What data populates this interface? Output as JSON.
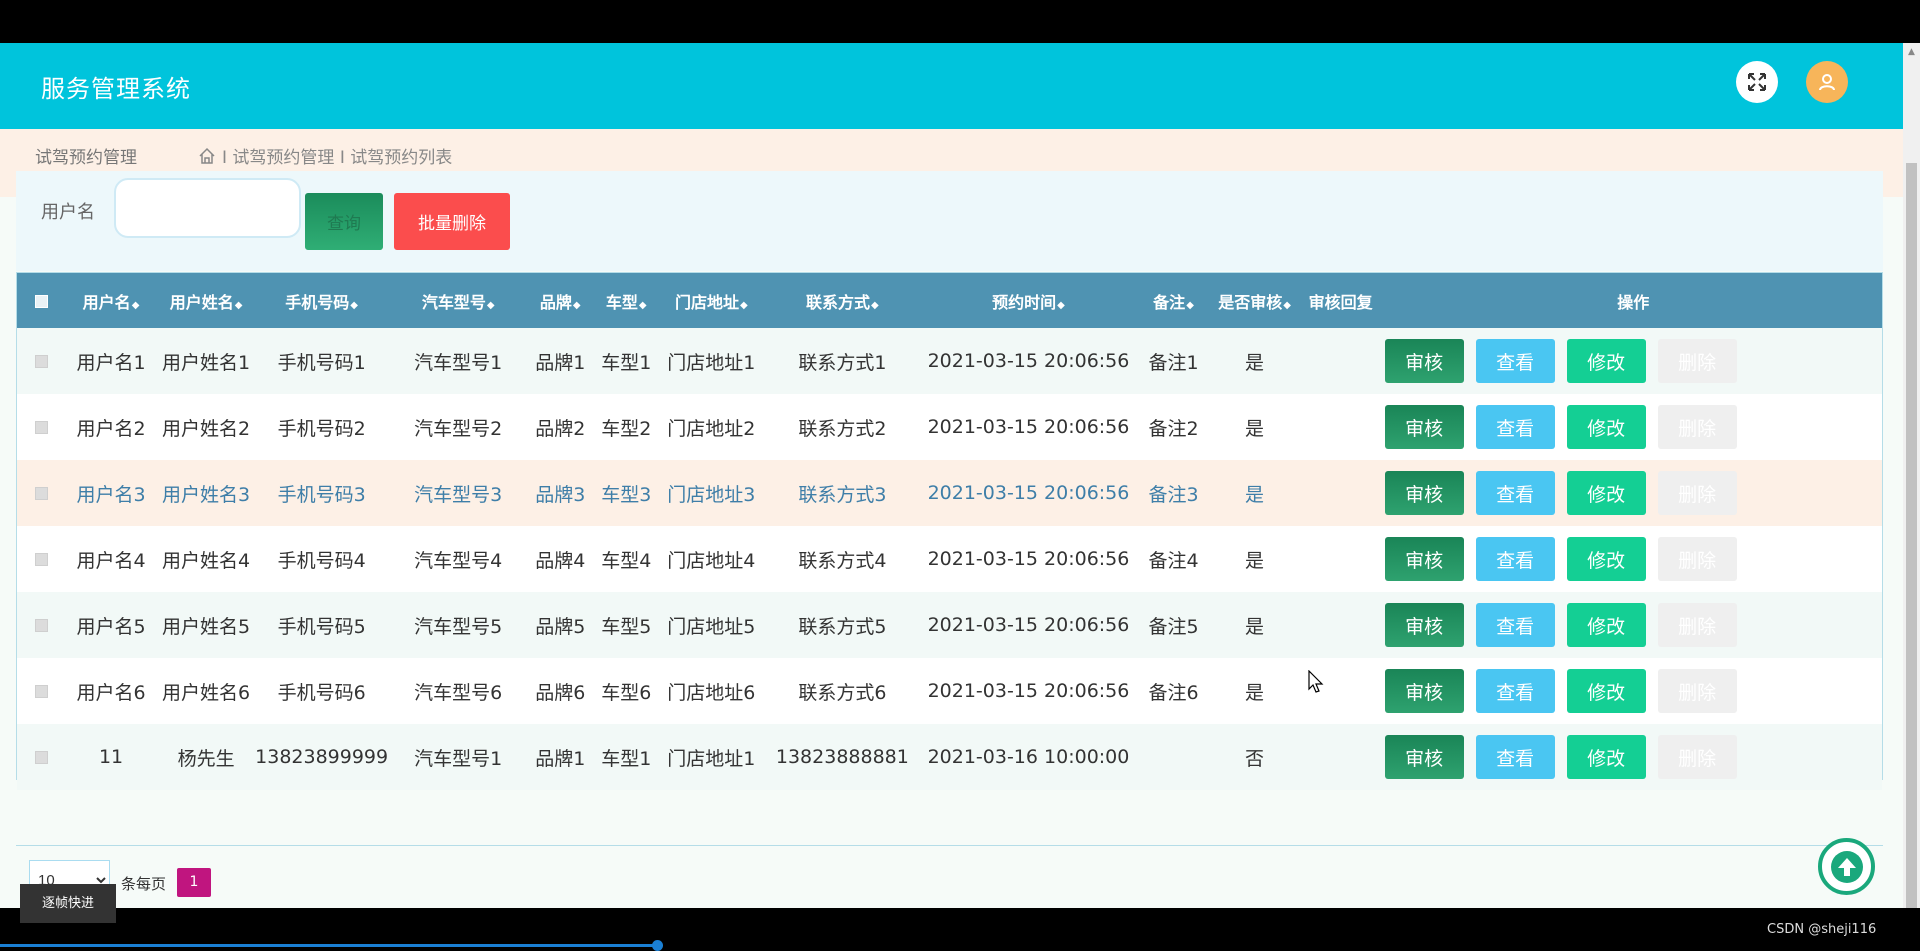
{
  "app": {
    "title": "服务管理系统",
    "colors": {
      "header": "#00c4dc",
      "table_header": "#4f93b2",
      "audit": "#1a8557",
      "view": "#4ac6f2",
      "edit": "#14cf94",
      "delete": "#fb4d4d",
      "page_active": "#c0157f"
    }
  },
  "breadcrumb": {
    "section": "试驾预约管理",
    "icon": "home-icon",
    "trail": "I 试驾预约管理 I 试驾预约列表"
  },
  "search": {
    "label": "用户名",
    "value": "",
    "query_label": "查询",
    "batch_delete_label": "批量删除"
  },
  "table": {
    "headers": [
      "用户名",
      "用户姓名",
      "手机号码",
      "汽车型号",
      "品牌",
      "车型",
      "门店地址",
      "联系方式",
      "预约时间",
      "备注",
      "是否审核",
      "审核回复",
      "操作"
    ],
    "action_labels": {
      "audit": "审核",
      "view": "查看",
      "edit": "修改",
      "delete": "删除"
    },
    "rows": [
      [
        "用户名1",
        "用户姓名1",
        "手机号码1",
        "汽车型号1",
        "品牌1",
        "车型1",
        "门店地址1",
        "联系方式1",
        "2021-03-15 20:06:56",
        "备注1",
        "是",
        ""
      ],
      [
        "用户名2",
        "用户姓名2",
        "手机号码2",
        "汽车型号2",
        "品牌2",
        "车型2",
        "门店地址2",
        "联系方式2",
        "2021-03-15 20:06:56",
        "备注2",
        "是",
        ""
      ],
      [
        "用户名3",
        "用户姓名3",
        "手机号码3",
        "汽车型号3",
        "品牌3",
        "车型3",
        "门店地址3",
        "联系方式3",
        "2021-03-15 20:06:56",
        "备注3",
        "是",
        ""
      ],
      [
        "用户名4",
        "用户姓名4",
        "手机号码4",
        "汽车型号4",
        "品牌4",
        "车型4",
        "门店地址4",
        "联系方式4",
        "2021-03-15 20:06:56",
        "备注4",
        "是",
        ""
      ],
      [
        "用户名5",
        "用户姓名5",
        "手机号码5",
        "汽车型号5",
        "品牌5",
        "车型5",
        "门店地址5",
        "联系方式5",
        "2021-03-15 20:06:56",
        "备注5",
        "是",
        ""
      ],
      [
        "用户名6",
        "用户姓名6",
        "手机号码6",
        "汽车型号6",
        "品牌6",
        "车型6",
        "门店地址6",
        "联系方式6",
        "2021-03-15 20:06:56",
        "备注6",
        "是",
        ""
      ],
      [
        "11",
        "杨先生",
        "13823899999",
        "汽车型号1",
        "品牌1",
        "车型1",
        "门店地址1",
        "13823888881",
        "2021-03-16 10:00:00",
        "",
        "否",
        ""
      ]
    ]
  },
  "pager": {
    "page_size": "10",
    "per_page_label": "条每页",
    "current_page": "1"
  },
  "overlay": {
    "tooltip": "逐帧快进",
    "watermark": "CSDN @sheji116"
  }
}
